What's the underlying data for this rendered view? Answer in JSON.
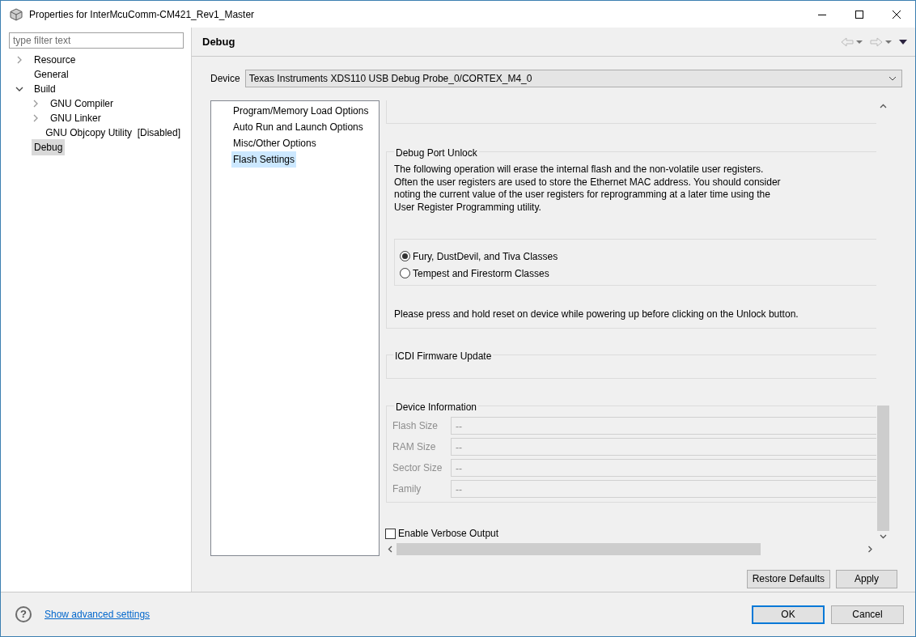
{
  "window": {
    "title": "Properties for InterMcuComm-CM421_Rev1_Master"
  },
  "filter": {
    "placeholder": "type filter text"
  },
  "tree": [
    {
      "label": "Resource",
      "expanded": false,
      "selected": false
    },
    {
      "label": "General",
      "selected": false
    },
    {
      "label": "Build",
      "expanded": true,
      "selected": false,
      "children": [
        {
          "label": "GNU Compiler",
          "expanded": false,
          "selected": false
        },
        {
          "label": "GNU Linker",
          "expanded": false,
          "selected": false
        },
        {
          "label": "GNU Objcopy Utility  [Disabled]",
          "selected": false
        }
      ]
    },
    {
      "label": "Debug",
      "selected": true
    }
  ],
  "page": {
    "title": "Debug"
  },
  "device": {
    "label": "Device",
    "value": "Texas Instruments XDS110 USB Debug Probe_0/CORTEX_M4_0"
  },
  "categories": [
    {
      "label": "Program/Memory Load Options",
      "selected": false
    },
    {
      "label": "Auto Run and Launch Options",
      "selected": false
    },
    {
      "label": "Misc/Other Options",
      "selected": false
    },
    {
      "label": "Flash Settings",
      "selected": true
    }
  ],
  "debug_port_unlock": {
    "title": "Debug Port Unlock",
    "description": "The following operation will erase the internal flash and the non-volatile user registers.\nOften the user registers are used to store the Ethernet MAC address. You should consider\nnoting the current value of the user registers for reprogramming at a later time using the\nUser Register Programming utility.",
    "options": [
      {
        "label": "Fury, DustDevil, and Tiva Classes",
        "selected": true
      },
      {
        "label": "Tempest and Firestorm Classes",
        "selected": false
      }
    ],
    "note": "Please press and hold reset on device while powering up before clicking on the Unlock button."
  },
  "icdi_firmware_update": {
    "title": "ICDI Firmware Update"
  },
  "device_information": {
    "title": "Device Information",
    "fields": [
      {
        "label": "Flash Size",
        "value": "--",
        "disabled": true
      },
      {
        "label": "RAM Size",
        "value": "--",
        "disabled": true
      },
      {
        "label": "Sector Size",
        "value": "--",
        "disabled": true
      },
      {
        "label": "Family",
        "value": "--",
        "disabled": true
      }
    ]
  },
  "verbose_output": {
    "label": "Enable Verbose Output",
    "checked": false
  },
  "page_buttons": [
    "Restore Defaults",
    "Apply"
  ],
  "footer": {
    "help": "?",
    "link": "Show advanced settings",
    "buttons": [
      {
        "label": "OK",
        "default": true
      },
      {
        "label": "Cancel",
        "default": false
      }
    ]
  }
}
